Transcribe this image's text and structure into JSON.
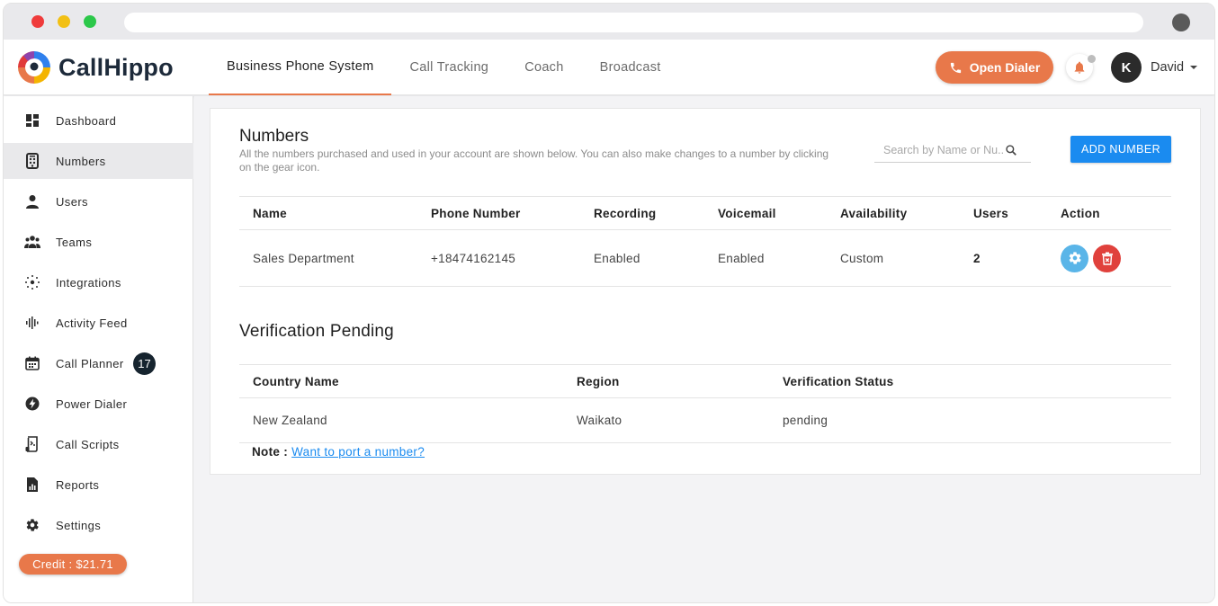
{
  "app": {
    "name": "CallHippo"
  },
  "nav": {
    "tabs": [
      {
        "label": "Business Phone System",
        "active": true
      },
      {
        "label": "Call Tracking"
      },
      {
        "label": "Coach"
      },
      {
        "label": "Broadcast"
      }
    ]
  },
  "header": {
    "open_dialer_label": "Open Dialer",
    "avatar_initial": "K",
    "user_name": "David"
  },
  "sidebar": {
    "items": [
      {
        "label": "Dashboard",
        "icon": "dashboard-icon"
      },
      {
        "label": "Numbers",
        "icon": "numbers-icon",
        "active": true
      },
      {
        "label": "Users",
        "icon": "user-icon"
      },
      {
        "label": "Teams",
        "icon": "teams-icon"
      },
      {
        "label": "Integrations",
        "icon": "integrations-icon"
      },
      {
        "label": "Activity Feed",
        "icon": "activity-icon"
      },
      {
        "label": "Call Planner",
        "icon": "calendar-icon",
        "badge": "17"
      },
      {
        "label": "Power Dialer",
        "icon": "bolt-icon"
      },
      {
        "label": "Call Scripts",
        "icon": "script-icon"
      },
      {
        "label": "Reports",
        "icon": "reports-icon"
      },
      {
        "label": "Settings",
        "icon": "gear-icon"
      }
    ],
    "credit": "Credit : $21.71"
  },
  "numbers": {
    "title": "Numbers",
    "description": "All the numbers purchased and used in your account are shown below. You can also make changes to a number by clicking on the gear icon.",
    "search_placeholder": "Search by Name or Nu...",
    "add_button": "ADD NUMBER",
    "columns": [
      "Name",
      "Phone Number",
      "Recording",
      "Voicemail",
      "Availability",
      "Users",
      "Action"
    ],
    "rows": [
      {
        "name": "Sales Department",
        "phone": "+18474162145",
        "recording": "Enabled",
        "voicemail": "Enabled",
        "availability": "Custom",
        "users": "2"
      }
    ]
  },
  "verification": {
    "title": "Verification Pending",
    "columns": [
      "Country Name",
      "Region",
      "Verification Status"
    ],
    "rows": [
      {
        "country": "New Zealand",
        "region": "Waikato",
        "status": "pending"
      }
    ]
  },
  "note": {
    "label": "Note :",
    "link": "Want to port a number?"
  },
  "colors": {
    "accent": "#e8784a",
    "primary_button": "#1a8bf0",
    "gear_button": "#5ab5e8",
    "delete_button": "#e0413c"
  }
}
